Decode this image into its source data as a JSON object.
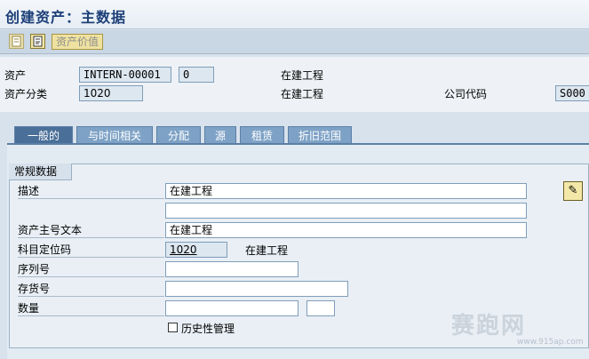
{
  "window": {
    "title": "创建资产：主数据"
  },
  "toolbar": {
    "value_button_label": "资产价值"
  },
  "header": {
    "asset_label": "资产",
    "asset_number": "INTERN-00001",
    "asset_subnumber": "0",
    "asset_description": "在建工程",
    "asset_class_label": "资产分类",
    "asset_class": "1020",
    "asset_class_description": "在建工程",
    "company_code_label": "公司代码",
    "company_code": "S000"
  },
  "tabs": [
    {
      "label": "一般的",
      "active": true
    },
    {
      "label": "与时间相关"
    },
    {
      "label": "分配"
    },
    {
      "label": "源"
    },
    {
      "label": "租赁"
    },
    {
      "label": "折旧范围"
    }
  ],
  "general": {
    "group_title": "常规数据",
    "description_label": "描述",
    "description_1": "在建工程",
    "description_2": "",
    "main_text_label": "资产主号文本",
    "main_text": "在建工程",
    "account_det_label": "科目定位码",
    "account_det": "1020",
    "account_det_description": "在建工程",
    "serial_label": "序列号",
    "serial": "",
    "inventory_label": "存货号",
    "inventory": "",
    "quantity_label": "数量",
    "quantity": "",
    "unit": "",
    "history_label": "历史性管理"
  },
  "watermark": {
    "text": "赛跑网",
    "url": "www.915ap.com"
  }
}
